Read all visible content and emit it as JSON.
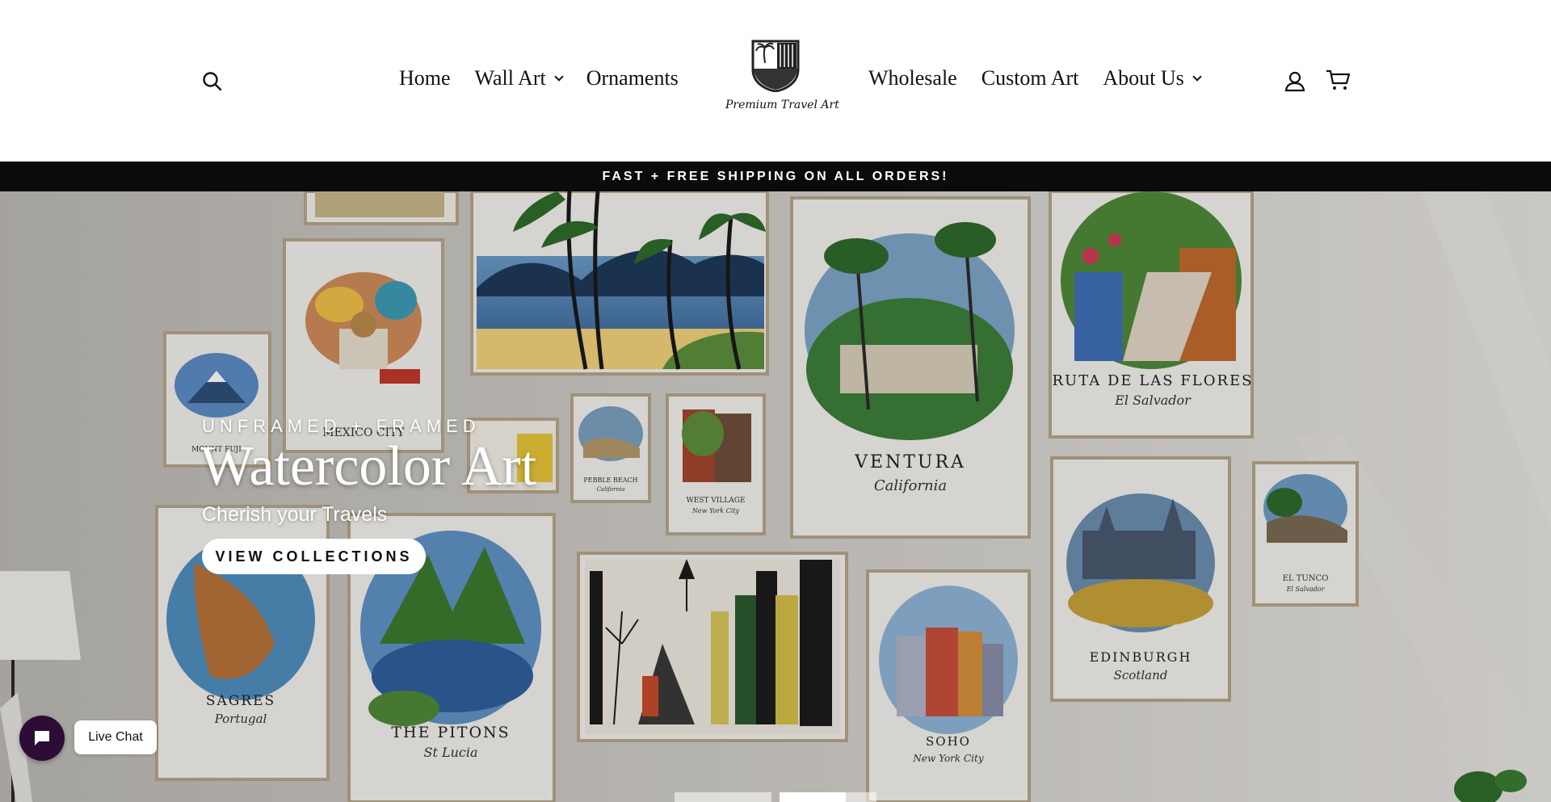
{
  "header": {
    "nav_left": [
      {
        "label": "Home",
        "has_dropdown": false
      },
      {
        "label": "Wall Art",
        "has_dropdown": true
      },
      {
        "label": "Ornaments",
        "has_dropdown": false
      }
    ],
    "nav_right": [
      {
        "label": "Wholesale",
        "has_dropdown": false
      },
      {
        "label": "Custom Art",
        "has_dropdown": false
      },
      {
        "label": "About Us",
        "has_dropdown": true
      }
    ],
    "logo_text": "Premium Travel Art",
    "icons": [
      "search-icon",
      "account-icon",
      "cart-icon"
    ]
  },
  "announcement": "FAST + FREE SHIPPING ON ALL ORDERS!",
  "hero": {
    "kicker": "UNFRAMED + FRAMED",
    "title": "Watercolor Art",
    "subtitle": "Cherish your Travels",
    "cta": "VIEW COLLECTIONS",
    "slide_count": 3,
    "active_slide": 2,
    "prints": [
      {
        "title": "MOUNT FUJI",
        "subtitle": ""
      },
      {
        "title": "MEXICO CITY",
        "subtitle": "Mexico"
      },
      {
        "title": "PEBBLE BEACH",
        "subtitle": "California"
      },
      {
        "title": "WEST VILLAGE",
        "subtitle": "New York City"
      },
      {
        "title": "VENTURA",
        "subtitle": "California"
      },
      {
        "title": "RUTA DE LAS FLORES",
        "subtitle": "El Salvador"
      },
      {
        "title": "EL TUNCO",
        "subtitle": "El Salvador"
      },
      {
        "title": "SAGRES",
        "subtitle": "Portugal"
      },
      {
        "title": "THE PITONS",
        "subtitle": "St Lucia"
      },
      {
        "title": "EDINBURGH",
        "subtitle": "Scotland"
      },
      {
        "title": "SOHO",
        "subtitle": "New York City"
      }
    ]
  },
  "chat": {
    "label": "Live Chat"
  },
  "colors": {
    "announcement_bg": "#0b0b0b",
    "chat_bg": "#2d0c36",
    "text": "#111111"
  }
}
